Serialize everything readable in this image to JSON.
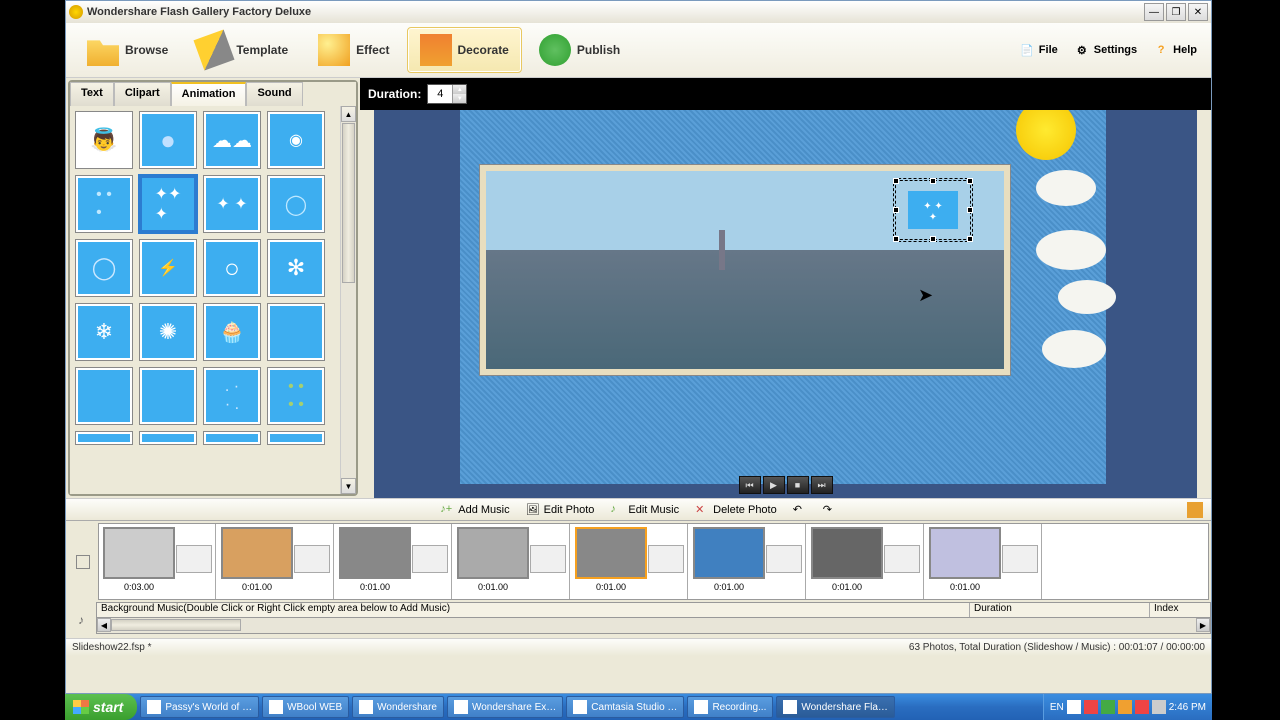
{
  "title_bar": {
    "title": "Wondershare Flash Gallery Factory Deluxe"
  },
  "toolbar": {
    "browse": "Browse",
    "template": "Template",
    "effect": "Effect",
    "decorate": "Decorate",
    "publish": "Publish",
    "file": "File",
    "settings": "Settings",
    "help": "Help"
  },
  "left_panel": {
    "tabs": {
      "text": "Text",
      "clipart": "Clipart",
      "animation": "Animation",
      "sound": "Sound"
    }
  },
  "duration": {
    "label": "Duration:",
    "value": "4"
  },
  "actions": {
    "add_music": "Add Music",
    "edit_photo": "Edit Photo",
    "edit_music": "Edit Music",
    "delete_photo": "Delete Photo"
  },
  "timeline": {
    "items": [
      {
        "time": "0:03.00"
      },
      {
        "time": "0:01.00"
      },
      {
        "time": "0:01.00"
      },
      {
        "time": "0:01.00"
      },
      {
        "time": "0:01.00"
      },
      {
        "time": "0:01.00"
      },
      {
        "time": "0:01.00"
      },
      {
        "time": "0:01.00"
      }
    ]
  },
  "music": {
    "hint": "Background Music(Double Click or Right Click empty area below to Add Music)",
    "col_duration": "Duration",
    "col_index": "Index"
  },
  "status": {
    "file": "Slideshow22.fsp *",
    "info": "63 Photos, Total Duration (Slideshow / Music) : 00:01:07 / 00:00:00"
  },
  "taskbar": {
    "start": "start",
    "tasks": [
      "Passy's World of …",
      "WBool WEB",
      "Wondershare",
      "Wondershare Ex…",
      "Camtasia Studio …",
      "Recording...",
      "Wondershare Fla…"
    ],
    "lang": "EN",
    "time": "2:46 PM"
  }
}
